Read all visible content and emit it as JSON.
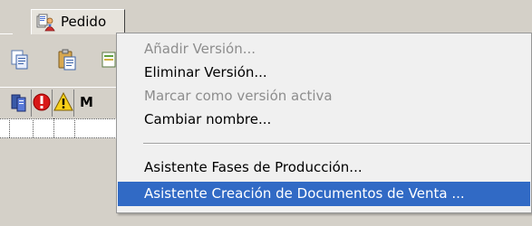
{
  "tab": {
    "label": "Pedido",
    "icon": "order-icon"
  },
  "toolbar": {
    "buttons": [
      "copy-icon",
      "paste-icon",
      "export-icon"
    ]
  },
  "grid": {
    "header_icons": [
      "document-icon",
      "error-icon",
      "warning-icon"
    ],
    "header_partial_text": "M"
  },
  "context_menu": {
    "items": [
      {
        "label": "Añadir Versión...",
        "enabled": false
      },
      {
        "label": "Eliminar Versión...",
        "enabled": true
      },
      {
        "label": "Marcar como versión activa",
        "enabled": false
      },
      {
        "label": "Cambiar nombre...",
        "enabled": true
      },
      {
        "label": "Asistente Fases de Producción...",
        "enabled": true
      },
      {
        "label": "Asistente Creación de Documentos de Venta ...",
        "enabled": true,
        "selected": true
      }
    ]
  },
  "colors": {
    "selection": "#316ac5",
    "disabled_text": "#8d8d8d",
    "menu_background": "#f0f0f0",
    "window_background": "#d4d0c8"
  }
}
